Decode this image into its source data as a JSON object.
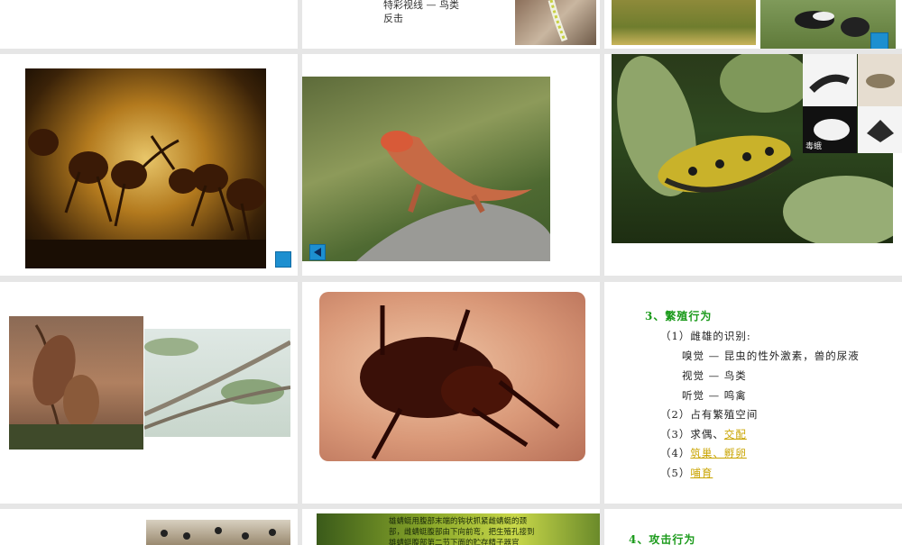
{
  "slide2": {
    "line1": "特彩视线 — 鸟类",
    "line2": "反击"
  },
  "slide3": {
    "moth_caption": "毒蛾"
  },
  "slide9": {
    "title": "3、繁殖行为",
    "l1": "（1）雌雄的识别:",
    "l2": "嗅觉 — 昆虫的性外激素，兽的尿液",
    "l3": "视觉 — 鸟类",
    "l4": "听觉 — 鸣禽",
    "l5": "（2）占有繁殖空间",
    "l6_prefix": "（3）求偶、",
    "l6_link": "交配",
    "l7_prefix": "（4）",
    "l7_link": "筑巢、孵卵",
    "l8_prefix": "（5）",
    "l8_link": "哺育"
  },
  "slide11": {
    "text1": "雄蜻蜓用腹部末端的钩状抓紧雌蜻蜓的颈",
    "text2": "部，雌蜻蜓腹部由下向前弯，把生殖孔接到",
    "text3": "雄蜻蜓腹部第二节下面的贮存精子器官"
  },
  "slide12": {
    "title": "4、攻击行为"
  },
  "colors": {
    "title_green": "#1a9a1a",
    "link_gold": "#c9a400",
    "nav_blue": "#1d8fd0"
  }
}
